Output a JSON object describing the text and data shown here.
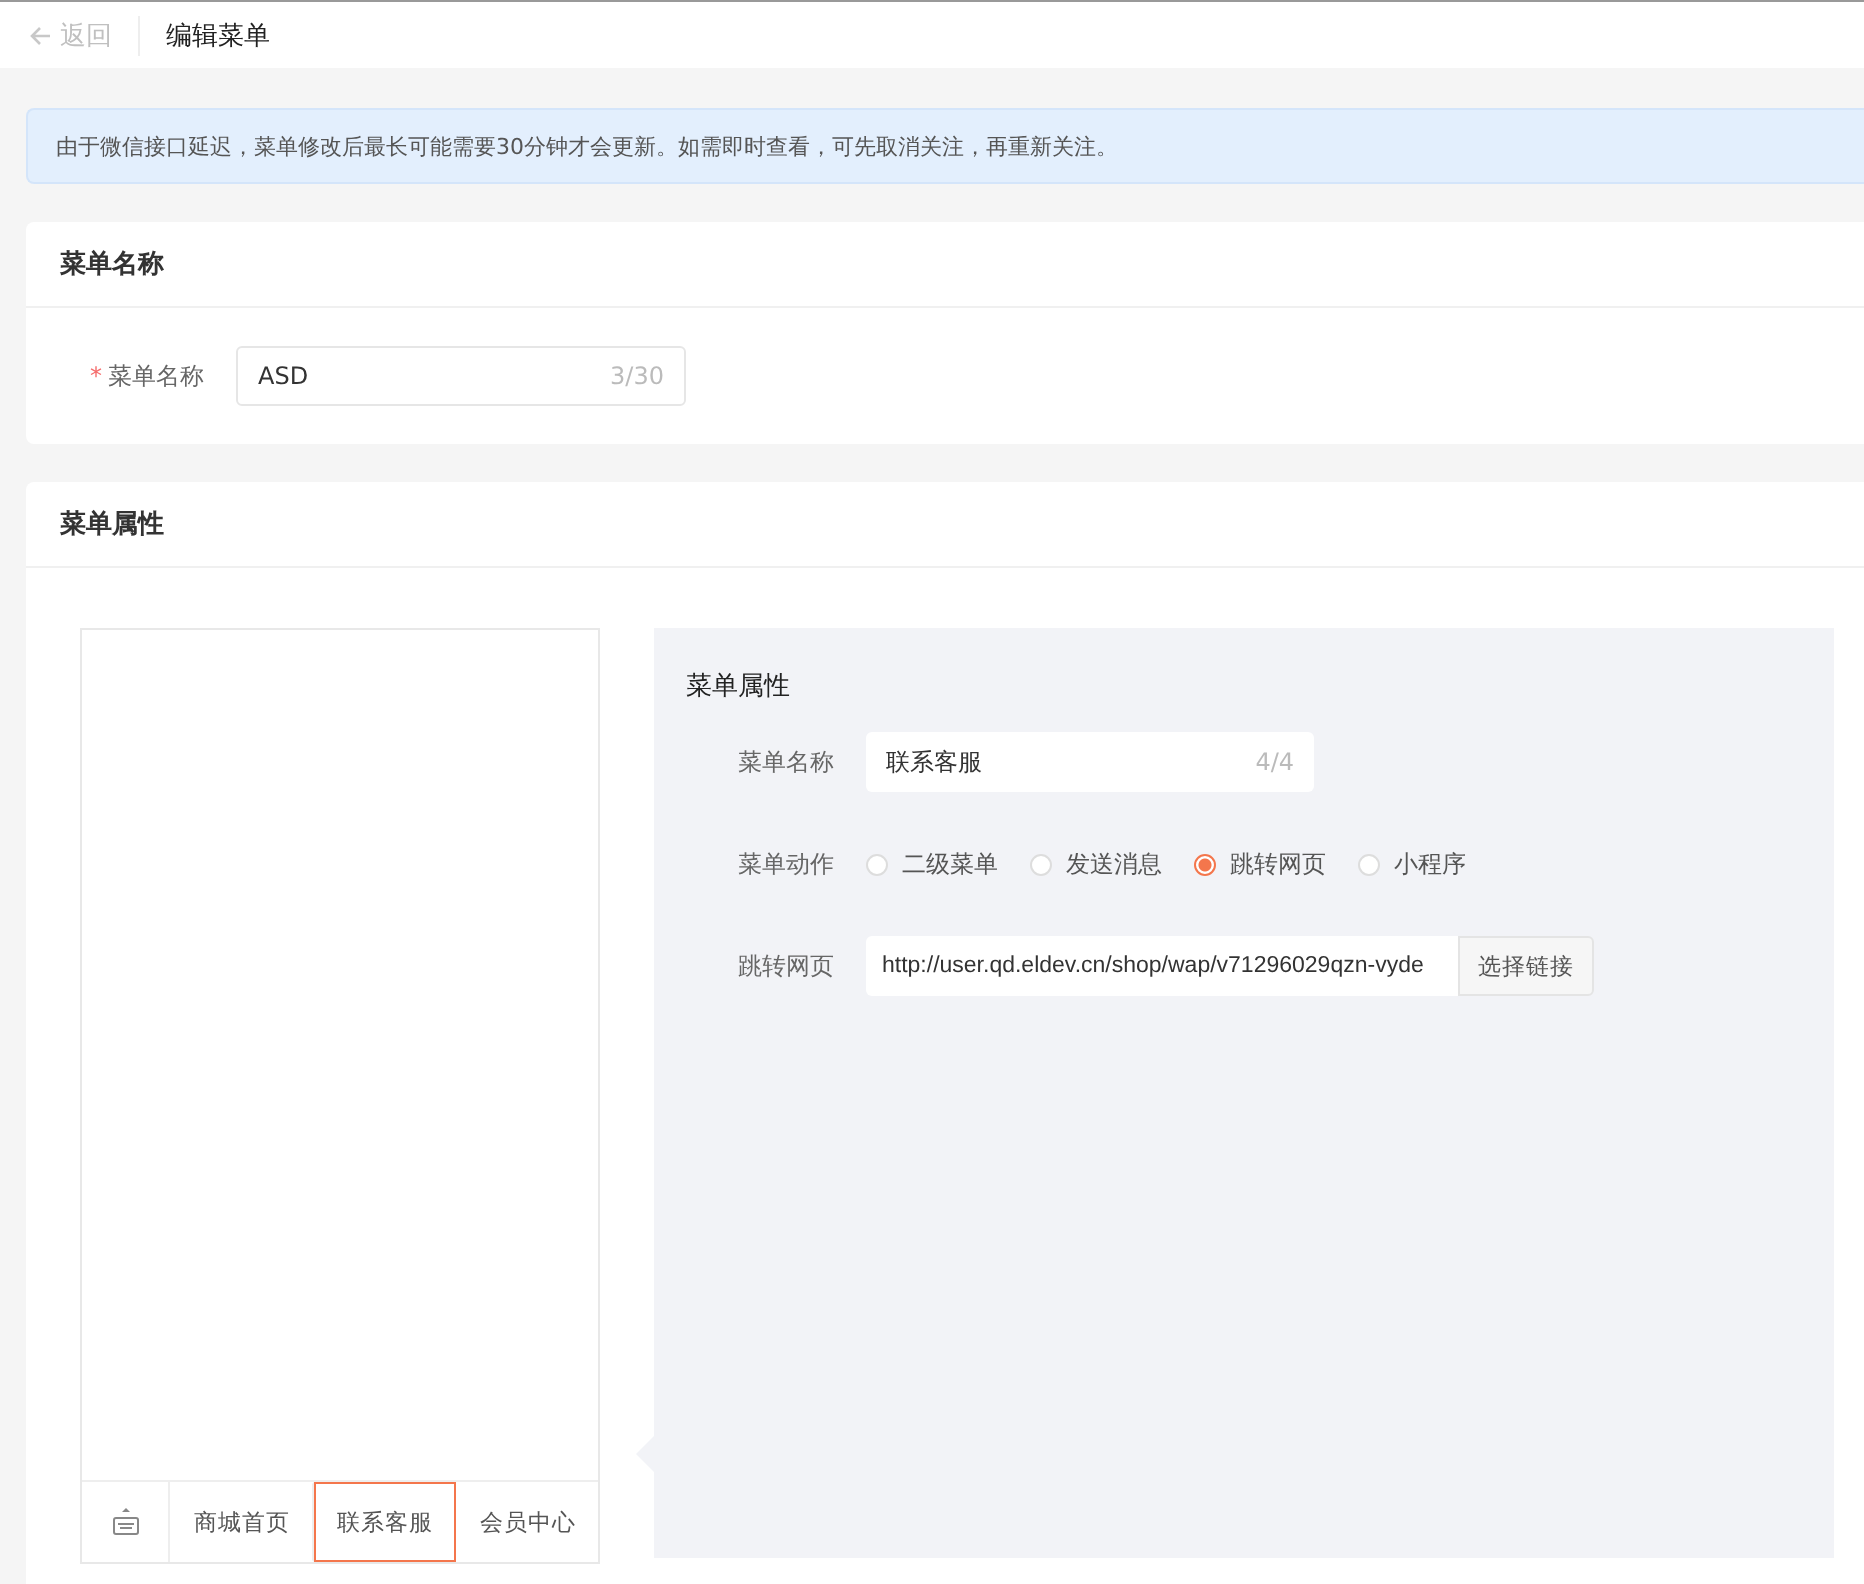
{
  "header": {
    "back": "返回",
    "title": "编辑菜单"
  },
  "notice": "由于微信接口延迟，菜单修改后最长可能需要30分钟才会更新。如需即时查看，可先取消关注，再重新关注。",
  "name_card": {
    "title": "菜单名称",
    "label": "菜单名称",
    "required_mark": "*",
    "value": "ASD",
    "count": "3/30"
  },
  "props_card": {
    "title": "菜单属性",
    "preview_tabs": [
      {
        "label": "商城首页",
        "selected": false
      },
      {
        "label": "联系客服",
        "selected": true
      },
      {
        "label": "会员中心",
        "selected": false
      }
    ],
    "panel": {
      "title": "菜单属性",
      "name_label": "菜单名称",
      "name_value": "联系客服",
      "name_count": "4/4",
      "action_label": "菜单动作",
      "actions": [
        {
          "label": "二级菜单",
          "selected": false
        },
        {
          "label": "发送消息",
          "selected": false
        },
        {
          "label": "跳转网页",
          "selected": true
        },
        {
          "label": "小程序",
          "selected": false
        }
      ],
      "url_label": "跳转网页",
      "url_value": "http://user.qd.eldev.cn/shop/wap/v71296029qzn-vyde",
      "url_button": "选择链接"
    }
  }
}
